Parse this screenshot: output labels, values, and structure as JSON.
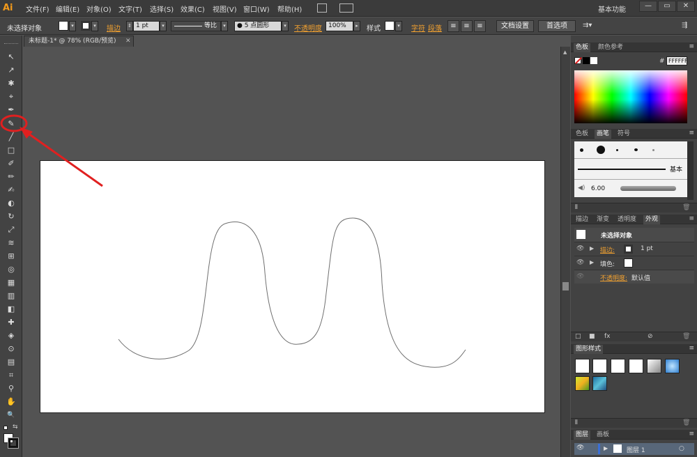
{
  "app": {
    "logo": "Ai",
    "workspace": "基本功能"
  },
  "menu": [
    "文件(F)",
    "编辑(E)",
    "对象(O)",
    "文字(T)",
    "选择(S)",
    "效果(C)",
    "视图(V)",
    "窗口(W)",
    "帮助(H)"
  ],
  "window_buttons": [
    "—",
    "▭",
    "✕"
  ],
  "control_bar": {
    "selection_label": "未选择对象",
    "stroke_label": "描边",
    "stroke_weight": "1 pt",
    "stroke_profile": "等比",
    "brush": "● 5 点圆形",
    "opacity_label": "不透明度",
    "opacity_value": "100%",
    "style_label": "样式",
    "char_label": "字符",
    "para_label": "段落",
    "doc_setup": "文档设置",
    "prefs": "首选项"
  },
  "document": {
    "tab_title": "未标题-1* @ 78% (RGB/预览)",
    "close": "✕"
  },
  "tools": [
    "↖",
    "↗",
    "✱",
    "⌖",
    "✒",
    "✎",
    "╱",
    "□",
    "✐",
    "✏",
    "✍",
    "◐",
    "↻",
    "⤢",
    "≋",
    "⊞",
    "◎",
    "▦",
    "▥",
    "◧",
    "✚",
    "◈",
    "⊙",
    "▤",
    "⌗",
    "⚲",
    "✋",
    "🔍"
  ],
  "colors": {
    "accent_orange": "#f0a030",
    "annotation_red": "#e02020",
    "curve_stroke": "#6e6e6e"
  },
  "color_panel": {
    "tabs": [
      "色板",
      "颜色参考"
    ],
    "hex_label": "#",
    "hex_value": "FFFFFF"
  },
  "brush_panel": {
    "tabs": [
      "色板",
      "画笔",
      "符号"
    ],
    "basic_label": "基本",
    "size_label": "6.00"
  },
  "appearance_panel": {
    "tabs": [
      "描边",
      "渐变",
      "透明度",
      "外观"
    ],
    "title": "未选择对象",
    "rows": [
      {
        "label": "描边:",
        "value": "1 pt"
      },
      {
        "label": "填色:",
        "value": ""
      },
      {
        "label": "不透明度:",
        "value": "默认值"
      }
    ]
  },
  "graphic_styles_panel": {
    "tabs": [
      "图形样式"
    ]
  },
  "layers_panel": {
    "tabs": [
      "图层",
      "画板"
    ],
    "layer_name": "图层 1"
  }
}
